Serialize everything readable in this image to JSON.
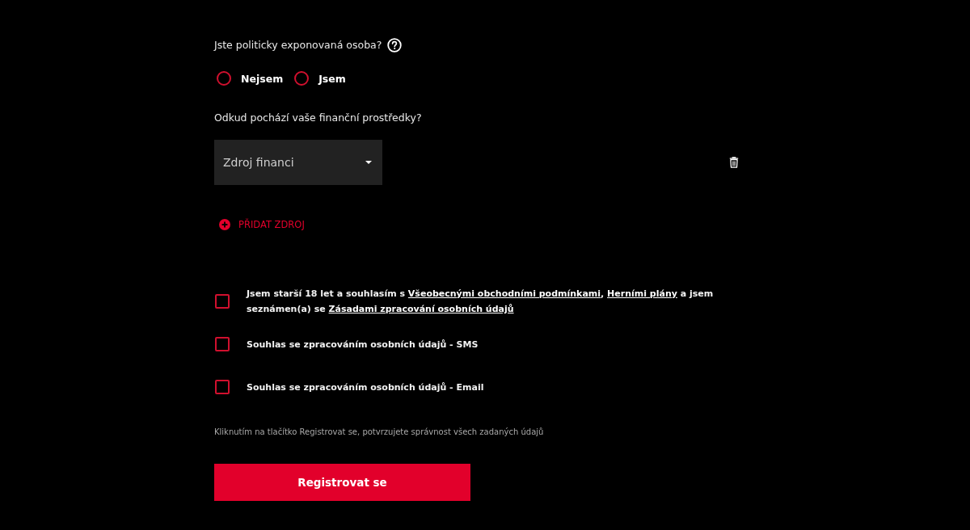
{
  "pep_question": {
    "label": "Jste politicky exponovaná osoba?",
    "options": [
      {
        "label": "Nejsem",
        "selected": false
      },
      {
        "label": "Jsem",
        "selected": false
      }
    ]
  },
  "funds_question": {
    "label": "Odkud pochází vaše finanční prostředky?",
    "sources": [
      {
        "placeholder": "Zdroj financi"
      }
    ],
    "add_button": "PŘIDAT ZDROJ"
  },
  "consents": [
    {
      "checked": false,
      "parts": [
        {
          "kind": "text",
          "text": "Jsem starší 18 let a souhlasím s "
        },
        {
          "kind": "link",
          "text": "Všeobecnými obchodními podmínkami"
        },
        {
          "kind": "text",
          "text": ", "
        },
        {
          "kind": "link",
          "text": "Herními plány"
        },
        {
          "kind": "text",
          "text": " a jsem seznámen(a) se "
        },
        {
          "kind": "link",
          "text": "Zásadami zpracování osobních údajů"
        }
      ]
    },
    {
      "checked": false,
      "parts": [
        {
          "kind": "text",
          "text": "Souhlas se zpracováním osobních údajů - SMS"
        }
      ]
    },
    {
      "checked": false,
      "parts": [
        {
          "kind": "text",
          "text": "Souhlas se zpracováním osobních údajů - Email"
        }
      ]
    }
  ],
  "note": "Kliknutím na tlačítko Registrovat se, potvrzujete správnost všech zadaných údajů",
  "submit_button": "Registrovat se"
}
